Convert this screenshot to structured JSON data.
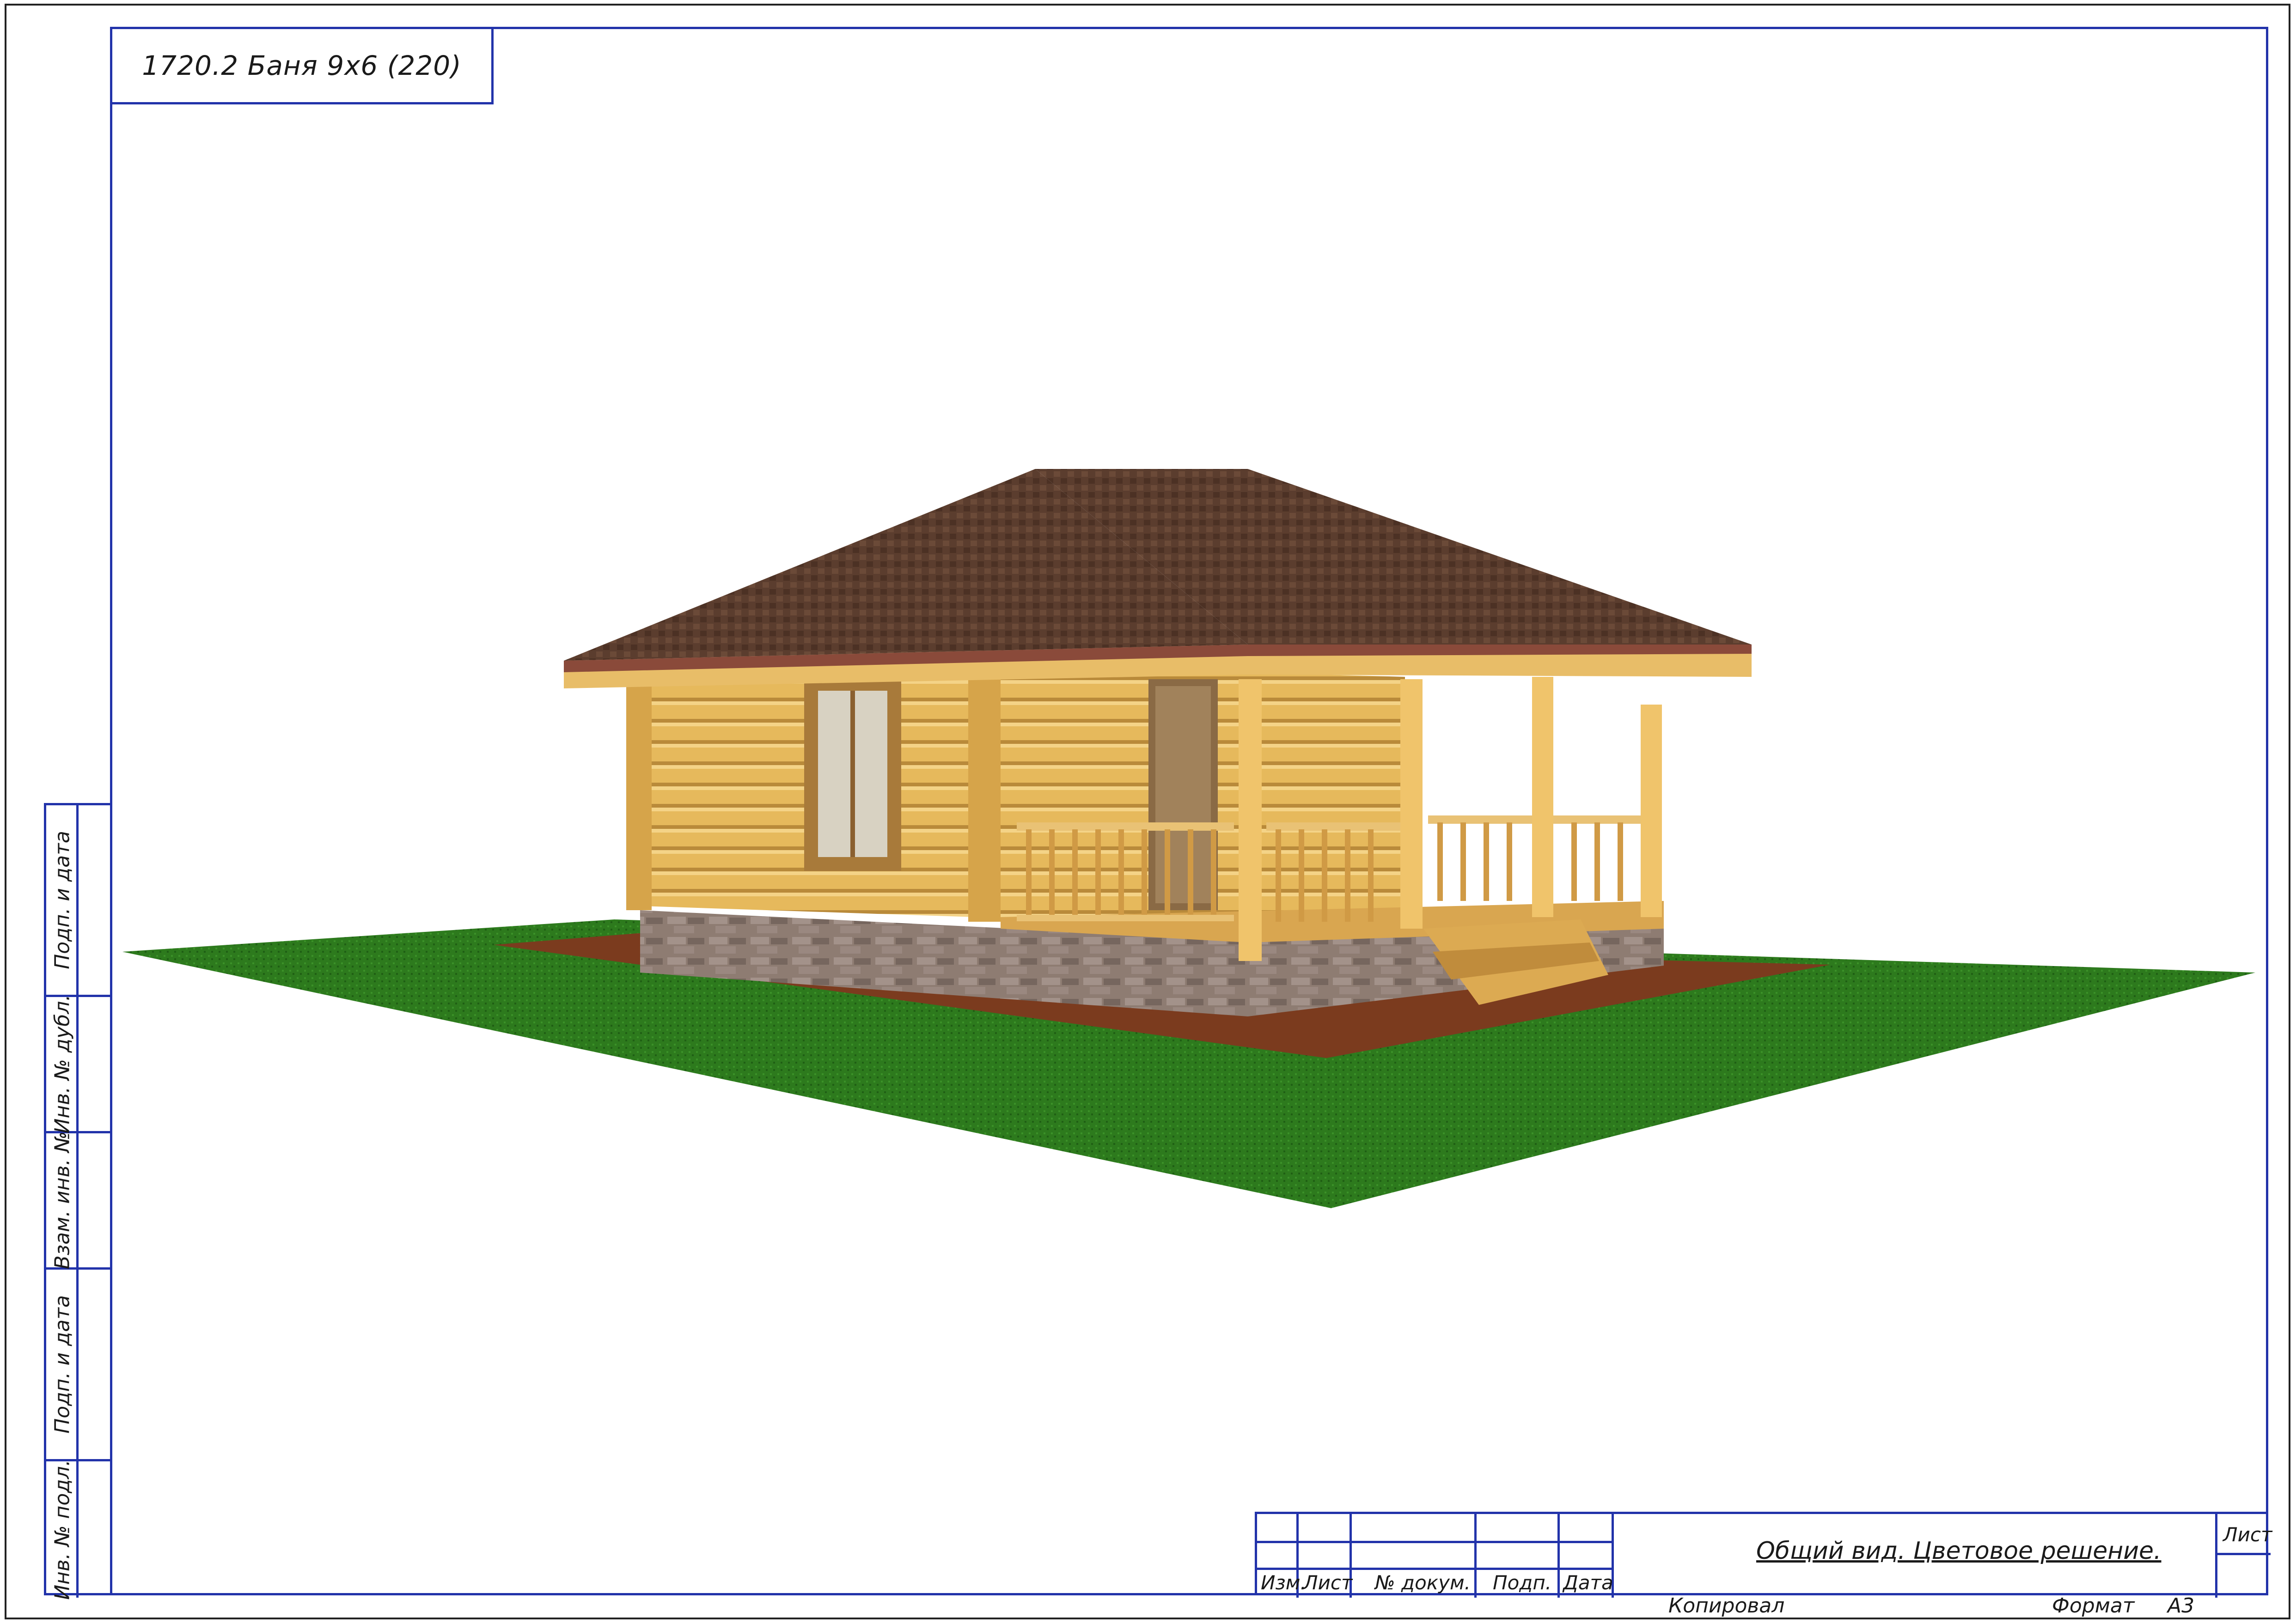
{
  "sheet": {
    "title": "1720.2 Баня 9х6 (220)"
  },
  "side_labels": [
    "Подп. и дата",
    "Инв. № дубл.",
    "Взам. инв. №",
    "Подп. и дата",
    "Инв. № подл."
  ],
  "stamp": {
    "col_izm": "Изм.",
    "col_list": "Лист",
    "col_doc": "№ докум.",
    "col_podp": "Подп.",
    "col_date": "Дата",
    "description": "Общий вид. Цветовое решение.",
    "sheet_label": "Лист"
  },
  "footer": {
    "copied": "Копировал",
    "format_label": "Формат",
    "format_value": "А3"
  },
  "colors": {
    "frame": "#2233aa",
    "grass": "#2f7d1f",
    "wood": "#e0b45a",
    "roof": "#5a3a2c",
    "stone": "#8a7a70",
    "mulch": "#7a3a1f"
  }
}
